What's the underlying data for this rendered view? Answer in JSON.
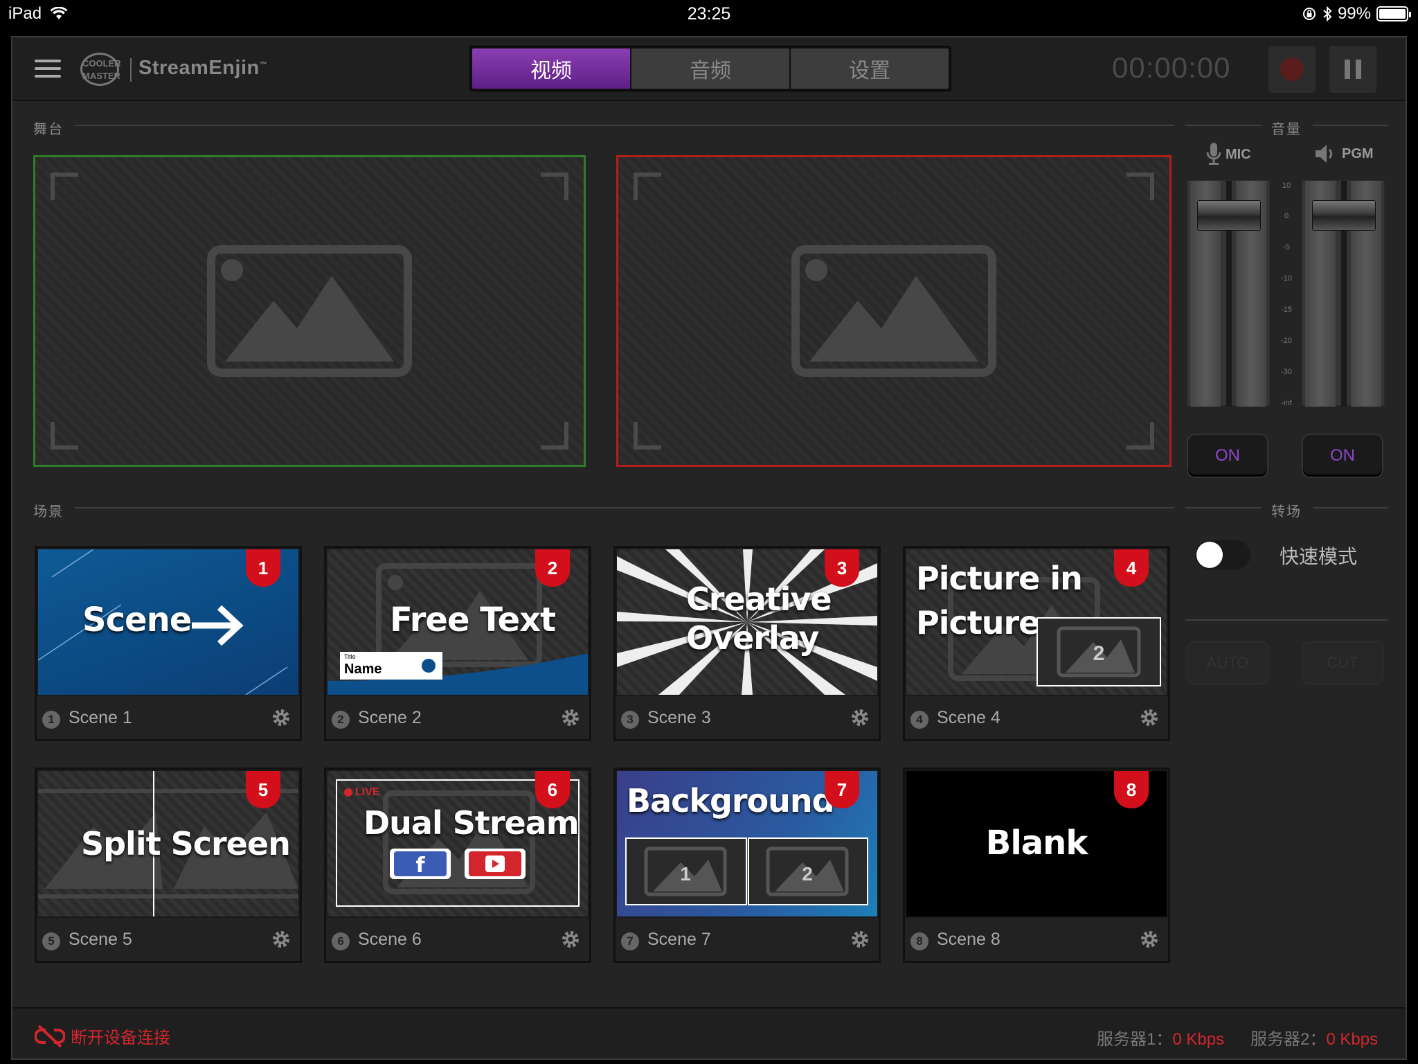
{
  "status_bar": {
    "device": "iPad",
    "time": "23:25",
    "battery": "99%"
  },
  "header": {
    "logo_text": "COOLER MASTER",
    "brand": "StreamEnjin",
    "brand_tm": "™",
    "tabs": [
      {
        "label": "视频",
        "active": true
      },
      {
        "label": "音频",
        "active": false
      },
      {
        "label": "设置",
        "active": false
      }
    ],
    "timer": "00:00:00"
  },
  "stage": {
    "label": "舞台",
    "preview_border": "#2f7d2a",
    "program_border": "#b21d1d"
  },
  "audio": {
    "label": "音量",
    "mic_label": "MIC",
    "pgm_label": "PGM",
    "scale": [
      "10",
      "0",
      "-5",
      "-10",
      "-15",
      "-20",
      "-30",
      "-inf"
    ],
    "mic_on": "ON",
    "pgm_on": "ON"
  },
  "scenes": {
    "label": "场景",
    "items": [
      {
        "num": "1",
        "name": "Scene 1",
        "thumb_text": "Scene"
      },
      {
        "num": "2",
        "name": "Scene 2",
        "thumb_text": "Free Text",
        "lower_third_title": "Title",
        "lower_third_name": "Name"
      },
      {
        "num": "3",
        "name": "Scene 3",
        "thumb_text_1": "Creative",
        "thumb_text_2": "Overlay"
      },
      {
        "num": "4",
        "name": "Scene 4",
        "thumb_text_1": "Picture in",
        "thumb_text_2": "Picture"
      },
      {
        "num": "5",
        "name": "Scene 5",
        "thumb_text": "Split Screen"
      },
      {
        "num": "6",
        "name": "Scene 6",
        "thumb_text": "Dual Stream",
        "live": "LIVE"
      },
      {
        "num": "7",
        "name": "Scene 7",
        "thumb_text": "Background"
      },
      {
        "num": "8",
        "name": "Scene 8",
        "thumb_text": "Blank"
      }
    ]
  },
  "transition": {
    "label": "转场",
    "fast_mode": "快速模式",
    "auto": "AUTO",
    "cut": "CUT"
  },
  "footer": {
    "disconnect": "断开设备连接",
    "server1_label": "服务器1：",
    "server1_value": "0 Kbps",
    "server2_label": "服务器2：",
    "server2_value": "0 Kbps"
  }
}
